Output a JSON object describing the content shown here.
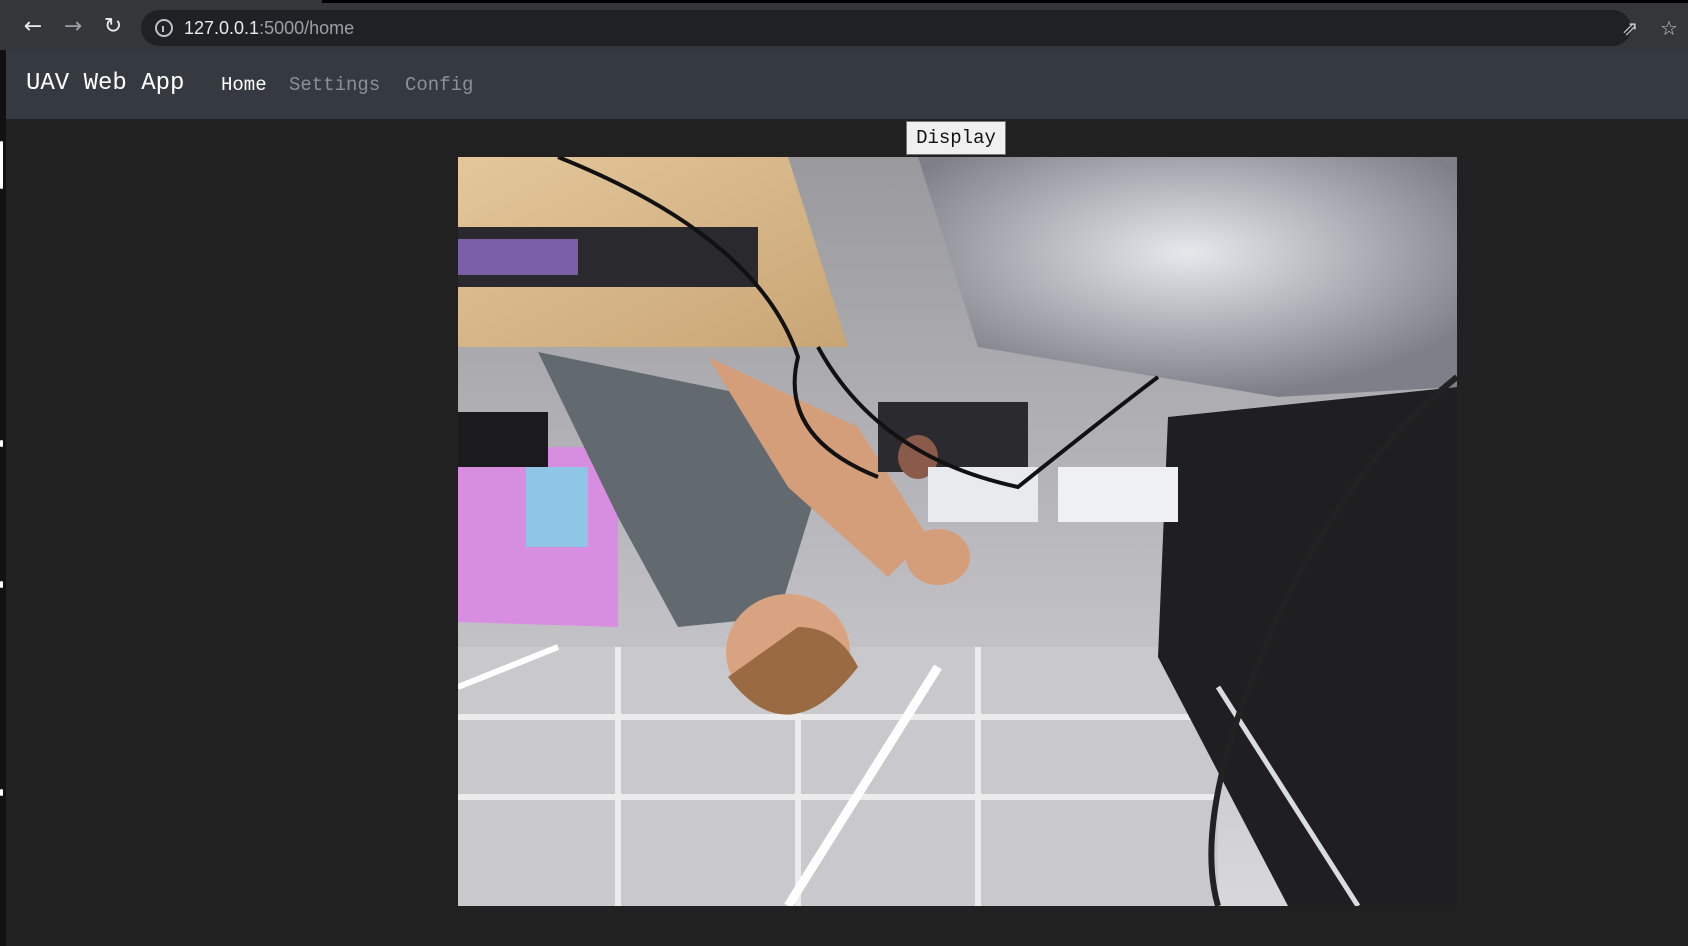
{
  "browser": {
    "url_host": "127.0.0.1",
    "url_path": ":5000/home",
    "icons": [
      "back-icon",
      "forward-icon",
      "reload-icon",
      "info-icon",
      "share-icon",
      "bookmark-star-icon"
    ]
  },
  "navbar": {
    "brand": "UAV Web App",
    "links": [
      {
        "label": "Home",
        "active": true
      },
      {
        "label": "Settings",
        "active": false
      },
      {
        "label": "Config",
        "active": false
      }
    ]
  },
  "main": {
    "display_button": "Display"
  },
  "colors": {
    "page_bg": "#212121",
    "navbar_bg": "#343a40",
    "browser_bg": "#35363a"
  }
}
